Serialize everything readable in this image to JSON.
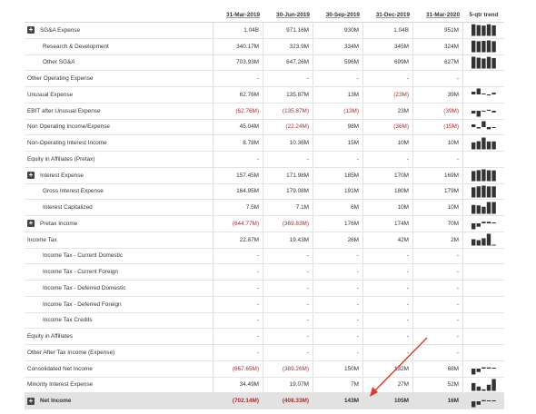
{
  "header": {
    "columns": [
      "31-Mar-2019",
      "30-Jun-2019",
      "30-Sep-2019",
      "31-Dec-2019",
      "31-Mar-2020"
    ],
    "trend_label": "5-qtr trend"
  },
  "rows": [
    {
      "label": "SG&A Expense",
      "expandable": true,
      "indent": false,
      "values": [
        "1.04B",
        "971.16M",
        "930M",
        "1.04B",
        "951M"
      ],
      "neg": [
        false,
        false,
        false,
        false,
        false
      ],
      "trend": [
        0.98,
        0.91,
        0.87,
        0.98,
        0.89
      ]
    },
    {
      "label": "Research & Development",
      "expandable": false,
      "indent": true,
      "values": [
        "340.17M",
        "323.9M",
        "334M",
        "345M",
        "324M"
      ],
      "neg": [
        false,
        false,
        false,
        false,
        false
      ],
      "trend": [
        0.98,
        0.93,
        0.96,
        1.0,
        0.93
      ]
    },
    {
      "label": "Other SG&A",
      "expandable": false,
      "indent": true,
      "values": [
        "703.93M",
        "647.26M",
        "596M",
        "699M",
        "627M"
      ],
      "neg": [
        false,
        false,
        false,
        false,
        false
      ],
      "trend": [
        1.0,
        0.92,
        0.85,
        0.99,
        0.89
      ]
    },
    {
      "label": "Other Operating Expense",
      "expandable": false,
      "indent": false,
      "values": [
        "-",
        "-",
        "-",
        "-",
        "-"
      ],
      "neg": [
        false,
        false,
        false,
        false,
        false
      ],
      "trend": []
    },
    {
      "label": "Unusual Expense",
      "expandable": false,
      "indent": false,
      "values": [
        "62.76M",
        "135.87M",
        "13M",
        "(23M)",
        "39M"
      ],
      "neg": [
        false,
        false,
        false,
        true,
        false
      ],
      "trend": [
        0.46,
        1.0,
        0.1,
        -0.17,
        0.29
      ]
    },
    {
      "label": "EBIT after Unusual Expense",
      "expandable": false,
      "indent": false,
      "values": [
        "(62.76M)",
        "(135.87M)",
        "(13M)",
        "23M",
        "(39M)"
      ],
      "neg": [
        true,
        true,
        true,
        false,
        true
      ],
      "trend": [
        -0.46,
        -1.0,
        -0.1,
        0.17,
        -0.29
      ]
    },
    {
      "label": "Non Operating Income/Expense",
      "expandable": false,
      "indent": false,
      "values": [
        "45.04M",
        "(22.24M)",
        "98M",
        "(36M)",
        "(15M)"
      ],
      "neg": [
        false,
        true,
        false,
        true,
        true
      ],
      "trend": [
        0.46,
        -0.23,
        1.0,
        -0.37,
        -0.15
      ]
    },
    {
      "label": "Non-Operating Interest Income",
      "expandable": false,
      "indent": false,
      "values": [
        "8.78M",
        "10.36M",
        "15M",
        "10M",
        "10M"
      ],
      "neg": [
        false,
        false,
        false,
        false,
        false
      ],
      "trend": [
        0.59,
        0.69,
        1.0,
        0.67,
        0.67
      ]
    },
    {
      "label": "Equity in Affiliates (Pretax)",
      "expandable": false,
      "indent": false,
      "values": [
        "-",
        "-",
        "-",
        "-",
        "-"
      ],
      "neg": [
        false,
        false,
        false,
        false,
        false
      ],
      "trend": []
    },
    {
      "label": "Interest Expense",
      "expandable": true,
      "indent": false,
      "values": [
        "157.45M",
        "171.98M",
        "185M",
        "170M",
        "169M"
      ],
      "neg": [
        false,
        false,
        false,
        false,
        false
      ],
      "trend": [
        0.85,
        0.93,
        1.0,
        0.92,
        0.91
      ]
    },
    {
      "label": "Gross Interest Expense",
      "expandable": false,
      "indent": true,
      "values": [
        "164.95M",
        "179.08M",
        "191M",
        "180M",
        "179M"
      ],
      "neg": [
        false,
        false,
        false,
        false,
        false
      ],
      "trend": [
        0.86,
        0.94,
        1.0,
        0.94,
        0.94
      ]
    },
    {
      "label": "Interest Capitalized",
      "expandable": false,
      "indent": true,
      "values": [
        "7.5M",
        "7.1M",
        "6M",
        "10M",
        "10M"
      ],
      "neg": [
        false,
        false,
        false,
        false,
        false
      ],
      "trend": [
        0.75,
        0.71,
        0.6,
        1.0,
        1.0
      ]
    },
    {
      "label": "Pretax Income",
      "expandable": true,
      "indent": false,
      "values": [
        "(644.77M)",
        "(369.83M)",
        "176M",
        "174M",
        "70M"
      ],
      "neg": [
        true,
        true,
        false,
        false,
        false
      ],
      "trend": [
        -1.0,
        -0.57,
        0.27,
        0.27,
        0.11
      ]
    },
    {
      "label": "Income Tax",
      "expandable": false,
      "indent": false,
      "values": [
        "22.87M",
        "19.43M",
        "26M",
        "42M",
        "2M"
      ],
      "neg": [
        false,
        false,
        false,
        false,
        false
      ],
      "trend": [
        0.54,
        0.46,
        0.62,
        1.0,
        0.05
      ]
    },
    {
      "label": "Income Tax - Current Domestic",
      "expandable": false,
      "indent": true,
      "values": [
        "-",
        "-",
        "-",
        "-",
        "-"
      ],
      "neg": [
        false,
        false,
        false,
        false,
        false
      ],
      "trend": []
    },
    {
      "label": "Income Tax - Current Foreign",
      "expandable": false,
      "indent": true,
      "values": [
        "-",
        "-",
        "-",
        "-",
        "-"
      ],
      "neg": [
        false,
        false,
        false,
        false,
        false
      ],
      "trend": []
    },
    {
      "label": "Income Tax - Deferred Domestic",
      "expandable": false,
      "indent": true,
      "values": [
        "-",
        "-",
        "-",
        "-",
        "-"
      ],
      "neg": [
        false,
        false,
        false,
        false,
        false
      ],
      "trend": []
    },
    {
      "label": "Income Tax - Deferred Foreign",
      "expandable": false,
      "indent": true,
      "values": [
        "-",
        "-",
        "-",
        "-",
        "-"
      ],
      "neg": [
        false,
        false,
        false,
        false,
        false
      ],
      "trend": []
    },
    {
      "label": "Income Tax Credits",
      "expandable": false,
      "indent": true,
      "values": [
        "-",
        "-",
        "-",
        "-",
        "-"
      ],
      "neg": [
        false,
        false,
        false,
        false,
        false
      ],
      "trend": []
    },
    {
      "label": "Equity in Affiliates",
      "expandable": false,
      "indent": false,
      "values": [
        "-",
        "-",
        "-",
        "-",
        "-"
      ],
      "neg": [
        false,
        false,
        false,
        false,
        false
      ],
      "trend": []
    },
    {
      "label": "Other After Tax Income (Expense)",
      "expandable": false,
      "indent": false,
      "values": [
        "-",
        "-",
        "-",
        "-",
        "-"
      ],
      "neg": [
        false,
        false,
        false,
        false,
        false
      ],
      "trend": []
    },
    {
      "label": "Consolidated Net Income",
      "expandable": false,
      "indent": false,
      "values": [
        "(667.65M)",
        "(389.26M)",
        "150M",
        "132M",
        "68M"
      ],
      "neg": [
        true,
        true,
        false,
        false,
        false
      ],
      "trend": [
        -1.0,
        -0.58,
        0.22,
        0.2,
        0.1
      ]
    },
    {
      "label": "Minority Interest Expense",
      "expandable": false,
      "indent": false,
      "values": [
        "34.49M",
        "19.07M",
        "7M",
        "27M",
        "52M"
      ],
      "neg": [
        false,
        false,
        false,
        false,
        false
      ],
      "trend": [
        0.66,
        0.37,
        0.13,
        0.52,
        1.0
      ]
    },
    {
      "label": "Net Income",
      "expandable": true,
      "indent": false,
      "highlight": true,
      "values": [
        "(702.14M)",
        "(408.33M)",
        "143M",
        "105M",
        "16M"
      ],
      "neg": [
        true,
        true,
        false,
        false,
        false
      ],
      "trend": [
        -1.0,
        -0.58,
        0.2,
        0.15,
        0.02
      ]
    }
  ],
  "colors": {
    "negative": "#b0282b",
    "spark": "#333333",
    "arrow": "#e0392b"
  },
  "icons": {
    "expand": "plus-box-icon"
  }
}
